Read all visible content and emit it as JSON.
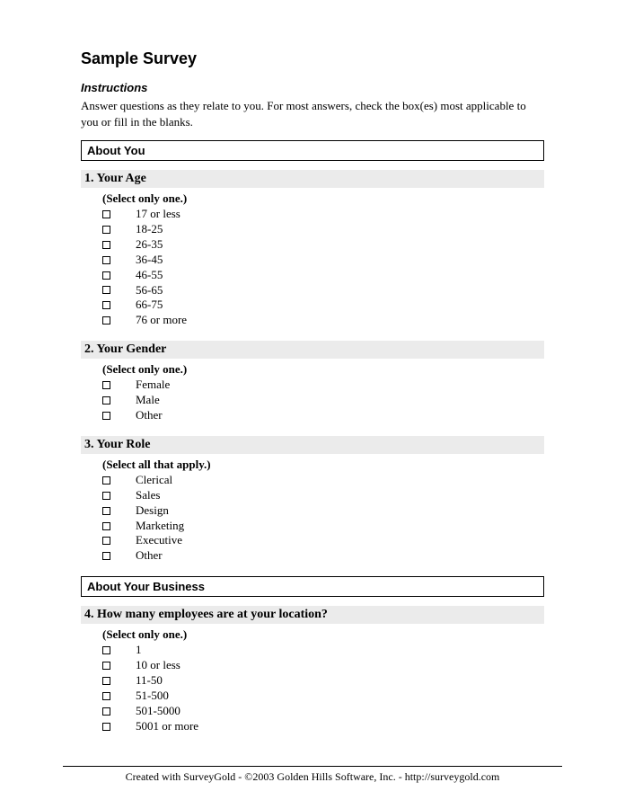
{
  "title": "Sample Survey",
  "instructions": {
    "heading": "Instructions",
    "text": "Answer questions as they relate to you. For most answers, check the box(es) most applicable to you or fill in the blanks."
  },
  "sections": [
    {
      "header": "About You",
      "questions": [
        {
          "number": "1.",
          "title": "Your Age",
          "instruction": "(Select only one.)",
          "options": [
            "17 or less",
            "18-25",
            "26-35",
            "36-45",
            "46-55",
            "56-65",
            "66-75",
            "76 or more"
          ]
        },
        {
          "number": "2.",
          "title": "Your Gender",
          "instruction": "(Select only one.)",
          "options": [
            "Female",
            "Male",
            "Other"
          ]
        },
        {
          "number": "3.",
          "title": "Your Role",
          "instruction": "(Select all that apply.)",
          "options": [
            "Clerical",
            "Sales",
            "Design",
            "Marketing",
            "Executive",
            "Other"
          ]
        }
      ]
    },
    {
      "header": "About Your Business",
      "questions": [
        {
          "number": "4.",
          "title": "How many employees are at your location?",
          "instruction": "(Select only one.)",
          "options": [
            "1",
            "10 or less",
            "11-50",
            "51-500",
            "501-5000",
            "5001 or more"
          ]
        }
      ]
    }
  ],
  "footer": "Created with SurveyGold - ©2003 Golden Hills Software, Inc. - http://surveygold.com"
}
